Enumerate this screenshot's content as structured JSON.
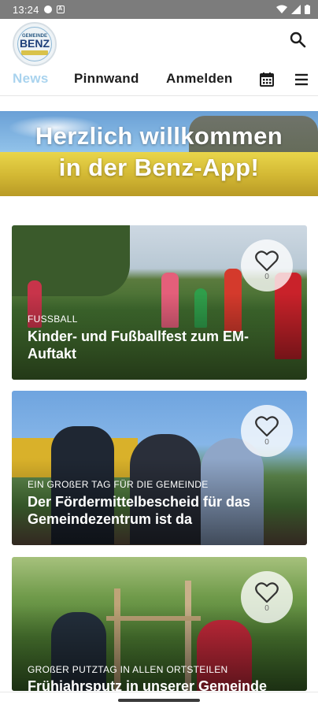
{
  "status_bar": {
    "time": "13:24"
  },
  "header": {
    "logo_small": "GEMEINDE",
    "logo_big": "BENZ"
  },
  "nav": {
    "items": [
      "News",
      "Pinnwand",
      "Anmelden"
    ],
    "active": "News"
  },
  "banner": {
    "line1": "Herzlich willkommen",
    "line2": "in der Benz-App!"
  },
  "cards": [
    {
      "category": "FUSSBALL",
      "title": "Kinder- und Fußballfest zum EM-Auftakt",
      "likes": "0"
    },
    {
      "category": "EIN GROßER TAG FÜR DIE GEMEINDE",
      "title": "Der Fördermittelbescheid für das Gemeindezentrum ist da",
      "likes": "0"
    },
    {
      "category": "GROßER PUTZTAG IN ALLEN ORTSTEILEN",
      "title": "Frühjahrsputz in unserer Gemeinde",
      "likes": "0"
    }
  ],
  "colors": {
    "accent": "#a9d3ee",
    "text": "#1d1d1d",
    "status_bar": "#7c7c7c"
  }
}
